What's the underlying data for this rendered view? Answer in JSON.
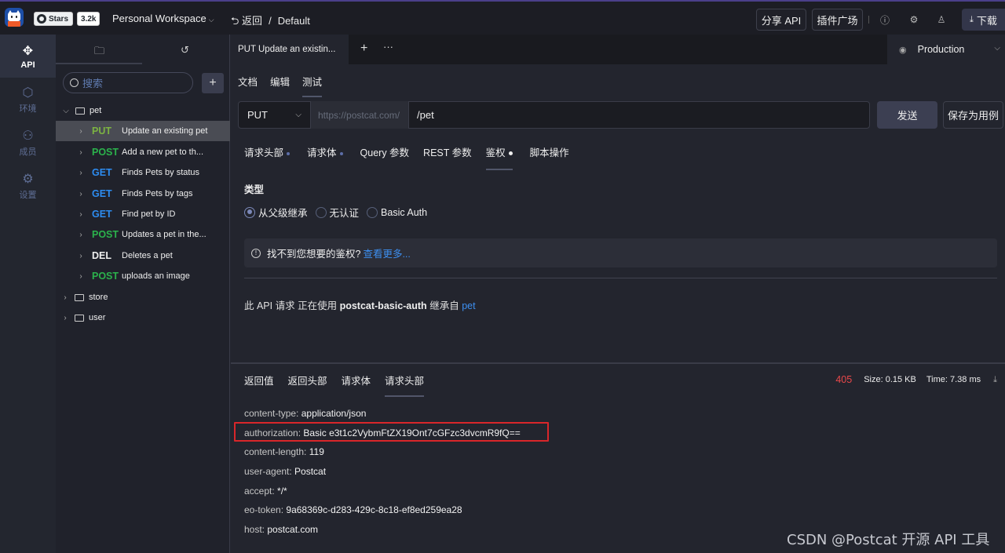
{
  "topbar": {
    "github_stars_label": "Stars",
    "github_stars_count": "3.2k",
    "workspace": "Personal Workspace",
    "back_label": "返回",
    "breadcrumb_sep": "/",
    "project": "Default",
    "share_api": "分享 API",
    "plugins": "插件广场",
    "download": "下载"
  },
  "rail": {
    "items": [
      {
        "label": "API",
        "icon": "api-icon"
      },
      {
        "label": "环境",
        "icon": "environment-icon"
      },
      {
        "label": "成员",
        "icon": "members-icon"
      },
      {
        "label": "设置",
        "icon": "settings-icon"
      }
    ]
  },
  "tree": {
    "search_placeholder": "搜索",
    "groups": [
      {
        "name": "pet",
        "expanded": true
      },
      {
        "name": "store",
        "expanded": false
      },
      {
        "name": "user",
        "expanded": false
      }
    ],
    "apis": [
      {
        "method": "PUT",
        "color": "#7cb342",
        "name": "Update an existing pet",
        "selected": true
      },
      {
        "method": "POST",
        "color": "#2bb24c",
        "name": "Add a new pet to th..."
      },
      {
        "method": "GET",
        "color": "#2d8cf0",
        "name": "Finds Pets by status"
      },
      {
        "method": "GET",
        "color": "#2d8cf0",
        "name": "Finds Pets by tags"
      },
      {
        "method": "GET",
        "color": "#2d8cf0",
        "name": "Find pet by ID"
      },
      {
        "method": "POST",
        "color": "#2bb24c",
        "name": "Updates a pet in the..."
      },
      {
        "method": "DEL",
        "color": "#eeeeee",
        "name": "Deletes a pet"
      },
      {
        "method": "POST",
        "color": "#2bb24c",
        "name": "uploads an image"
      }
    ]
  },
  "main": {
    "open_tab": "PUT  Update an existin...",
    "env": "Production",
    "modes": [
      "文档",
      "编辑",
      "测试"
    ],
    "request": {
      "method": "PUT",
      "base_url": "https://postcat.com/",
      "path": "/pet",
      "send": "发送",
      "save_as_case": "保存为用例"
    },
    "subtabs": [
      {
        "label": "请求头部",
        "dot": true
      },
      {
        "label": "请求体",
        "dot": true
      },
      {
        "label": "Query 参数",
        "dot": false
      },
      {
        "label": "REST 参数",
        "dot": false
      },
      {
        "label": "鉴权",
        "dot": true,
        "active": true
      },
      {
        "label": "脚本操作",
        "dot": false
      }
    ],
    "auth": {
      "type_label": "类型",
      "options": [
        "从父级继承",
        "无认证",
        "Basic Auth"
      ],
      "selected": "从父级继承",
      "hint_text": "找不到您想要的鉴权?",
      "hint_link": "查看更多...",
      "usage_prefix": "此 API 请求 正在使用",
      "usage_name": "postcat-basic-auth",
      "usage_mid": "继承自",
      "usage_link": "pet"
    }
  },
  "response": {
    "tabs": [
      "返回值",
      "返回头部",
      "请求体",
      "请求头部"
    ],
    "active_tab": "请求头部",
    "status": "405",
    "size": "Size: 0.15 KB",
    "time": "Time: 7.38 ms",
    "headers": [
      {
        "key": "content-type:",
        "value": "application/json"
      },
      {
        "key": "authorization:",
        "value": "Basic e3t1c2VybmFtZX19Ont7cGFzc3dvcmR9fQ=="
      },
      {
        "key": "content-length:",
        "value": "119"
      },
      {
        "key": "user-agent:",
        "value": "Postcat"
      },
      {
        "key": "accept:",
        "value": "*/*"
      },
      {
        "key": "eo-token:",
        "value": "9a68369c-d283-429c-8c18-ef8ed259ea28"
      },
      {
        "key": "host:",
        "value": "postcat.com"
      }
    ]
  },
  "watermark": "CSDN @Postcat 开源 API 工具"
}
